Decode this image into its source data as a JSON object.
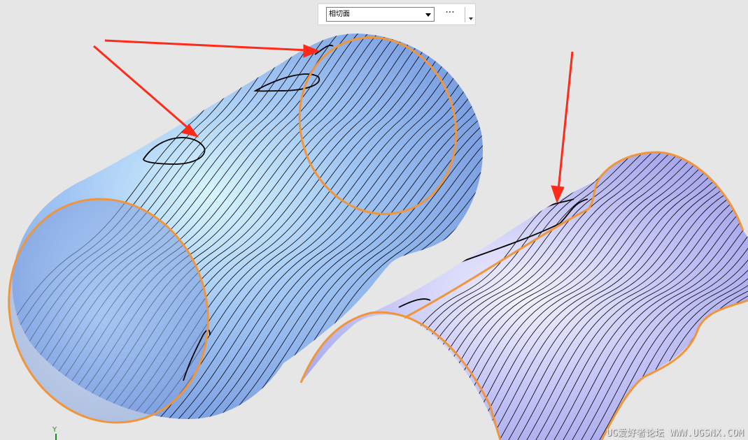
{
  "toolbar": {
    "selection_filter": "相切面",
    "more_label": "···"
  },
  "viewport": {
    "axis_label": "Y",
    "watermark": "UG爱好者论坛 WWW.UGSNX.COM"
  },
  "colors": {
    "background": "#e6e6e6",
    "left_surface": "#8fb2f0",
    "right_surface": "#b7b6f3",
    "edge_highlight": "#f0953a",
    "annotation_arrow": "#ff2a1a",
    "isoline": "#000000"
  },
  "icons": [
    "dropdown-arrow-icon",
    "more-options-icon",
    "toolbar-overflow-icon",
    "annotation-arrow-icon"
  ]
}
